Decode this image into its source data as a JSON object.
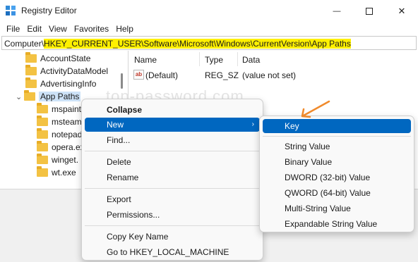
{
  "window": {
    "title": "Registry Editor",
    "minimize_glyph": "—",
    "maximize_glyph": "☐",
    "close_glyph": "✕"
  },
  "menubar": {
    "items": [
      "File",
      "Edit",
      "View",
      "Favorites",
      "Help"
    ]
  },
  "address": {
    "prefix": "Computer\\",
    "path": "HKEY_CURRENT_USER\\Software\\Microsoft\\Windows\\CurrentVersion\\App Paths"
  },
  "tree": {
    "items": [
      {
        "label": "AccountState",
        "expanded": false,
        "selected": false
      },
      {
        "label": "ActivityDataModel",
        "expanded": false,
        "selected": false
      },
      {
        "label": "AdvertisingInfo",
        "expanded": false,
        "selected": false
      },
      {
        "label": "App Paths",
        "expanded": true,
        "selected": true
      },
      {
        "label": "mspaint",
        "expanded": false,
        "selected": false
      },
      {
        "label": "msteam",
        "expanded": false,
        "selected": false
      },
      {
        "label": "notepad",
        "expanded": false,
        "selected": false
      },
      {
        "label": "opera.ex",
        "expanded": false,
        "selected": false
      },
      {
        "label": "winget.",
        "expanded": false,
        "selected": false
      },
      {
        "label": "wt.exe",
        "expanded": false,
        "selected": false
      }
    ]
  },
  "list": {
    "columns": [
      "Name",
      "Type",
      "Data"
    ],
    "rows": [
      {
        "name": "(Default)",
        "type": "REG_SZ",
        "data": "(value not set)",
        "icon": "ab-string-icon"
      }
    ]
  },
  "watermark": "top-password.com",
  "context_menu": {
    "items": [
      {
        "label": "Collapse",
        "bold": true
      },
      {
        "label": "New",
        "highlighted": true,
        "has_submenu": true
      },
      {
        "label": "Find..."
      },
      {
        "label": "Delete"
      },
      {
        "label": "Rename"
      },
      {
        "label": "Export"
      },
      {
        "label": "Permissions..."
      },
      {
        "label": "Copy Key Name"
      },
      {
        "label": "Go to HKEY_LOCAL_MACHINE"
      }
    ],
    "submenu_arrow": "›"
  },
  "submenu": {
    "items": [
      {
        "label": "Key",
        "highlighted": true
      },
      {
        "label": "String Value"
      },
      {
        "label": "Binary Value"
      },
      {
        "label": "DWORD (32-bit) Value"
      },
      {
        "label": "QWORD (64-bit) Value"
      },
      {
        "label": "Multi-String Value"
      },
      {
        "label": "Expandable String Value"
      }
    ]
  },
  "colors": {
    "highlight": "#0067c0",
    "address_highlight": "#fff000",
    "annotation_arrow": "#f08a2c",
    "folder": "#f3c243"
  }
}
